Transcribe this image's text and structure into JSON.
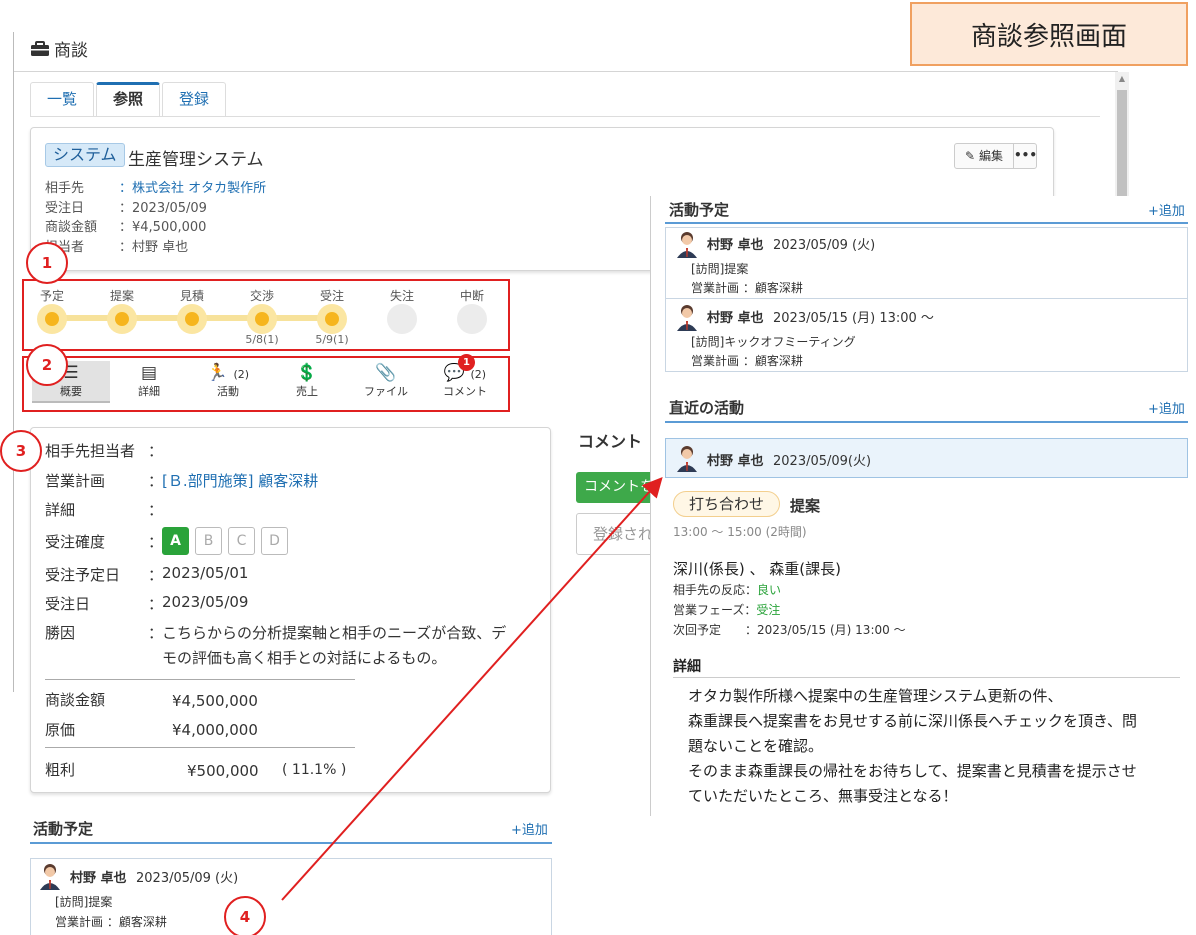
{
  "annotation": {
    "title": "商談参照画面",
    "markers": [
      "1",
      "2",
      "3",
      "4"
    ]
  },
  "header": {
    "title": "商談"
  },
  "tabs": [
    {
      "label": "一覧"
    },
    {
      "label": "参照"
    },
    {
      "label": "登録"
    }
  ],
  "deal": {
    "category": "システム",
    "name": "生産管理システム",
    "edit_label": "編集",
    "more_label": "•••",
    "info": [
      {
        "key": "相手先",
        "value": "：株式会社 オタカ製作所"
      },
      {
        "key": "受注日",
        "value": "：2023/05/09"
      },
      {
        "key": "商談金額",
        "value": "：¥4,500,000"
      },
      {
        "key": "担当者",
        "value": "：村野 卓也"
      }
    ]
  },
  "phases": [
    {
      "label": "予定",
      "state": "done",
      "date": ""
    },
    {
      "label": "提案",
      "state": "done",
      "date": ""
    },
    {
      "label": "見積",
      "state": "done",
      "date": ""
    },
    {
      "label": "交渉",
      "state": "done",
      "date": "5/8(1)"
    },
    {
      "label": "受注",
      "state": "done",
      "date": "5/9(1)"
    },
    {
      "label": "失注",
      "state": "none",
      "date": ""
    },
    {
      "label": "中断",
      "state": "none",
      "date": ""
    }
  ],
  "icon_tabs": [
    {
      "label": "概要",
      "icon": "list-icon",
      "glyph": "☰",
      "count": ""
    },
    {
      "label": "詳細",
      "icon": "clipboard-icon",
      "glyph": "▤",
      "count": ""
    },
    {
      "label": "活動",
      "icon": "running-icon",
      "glyph": "🏃",
      "count": "(2)"
    },
    {
      "label": "売上",
      "icon": "invoice-icon",
      "glyph": "💲",
      "count": ""
    },
    {
      "label": "ファイル",
      "icon": "paperclip-icon",
      "glyph": "📎",
      "count": ""
    },
    {
      "label": "コメント",
      "icon": "comment-icon",
      "glyph": "💬",
      "count": "(2)"
    }
  ],
  "comment_badge": "1",
  "detail": {
    "contact_label": "相手先担当者",
    "colon": "：",
    "plan_label": "営業計画",
    "plan_value": "[Ｂ.部門施策] 顧客深耕",
    "detail_label": "詳細",
    "grade_label": "受注確度",
    "grades": [
      "A",
      "B",
      "C",
      "D"
    ],
    "grade_selected": "A",
    "expected_label": "受注予定日",
    "expected_value": "2023/05/01",
    "order_label": "受注日",
    "order_value": "2023/05/09",
    "reason_label": "勝因",
    "reason_value": [
      "こちらからの分析提案軸と相手のニーズが合致、デ",
      "モの評価も高く相手との対話によるもの。"
    ],
    "amount_label": "商談金額",
    "amount_value": "¥4,500,000",
    "cost_label": "原価",
    "cost_value": "¥4,000,000",
    "profit_label": "粗利",
    "profit_value": "¥500,000",
    "profit_rate": "( 11.1% )"
  },
  "comments": {
    "title": "コメント",
    "button": "コメントを書く",
    "placeholder": "登録されたコメントはありません"
  },
  "left_schedule": {
    "title": "活動予定",
    "add": "+追加",
    "items": [
      {
        "name": "村野 卓也",
        "date": "2023/05/09 (火)",
        "type": "[訪問]提案",
        "plan": "営業計画 ：顧客深耕"
      }
    ]
  },
  "right_schedule": {
    "title": "活動予定",
    "add": "+追加",
    "items": [
      {
        "name": "村野 卓也",
        "date": "2023/05/09 (火)",
        "type": "[訪問]提案",
        "plan": "営業計画 ：顧客深耕"
      },
      {
        "name": "村野 卓也",
        "date": "2023/05/15 (月) 13:00 ～",
        "type": "[訪問]キックオフミーティング",
        "plan": "営業計画 ：顧客深耕"
      }
    ]
  },
  "recent": {
    "title": "直近の活動",
    "add": "+追加",
    "name": "村野 卓也",
    "date": "2023/05/09(火)",
    "badge": "打ち合わせ",
    "subject": "提案",
    "time": "13:00 ～ 15:00 (2時間)",
    "attendees": "深川(係長) 、 森重(課長)",
    "reaction_label": "相手先の反応：",
    "reaction_value": "良い",
    "phase_label": "営業フェーズ：",
    "phase_value": "受注",
    "next_label": "次回予定　　：",
    "next_value": "2023/05/15 (月) 13:00 ～",
    "detail_title": "詳細",
    "detail_lines": [
      "オタカ製作所様へ提案中の生産管理システム更新の件、",
      "森重課長へ提案書をお見せする前に深川係長へチェックを頂き、問",
      "題ないことを確認。",
      "そのまま森重課長の帰社をお待ちして、提案書と見積書を提示させ",
      "ていただいたところ、無事受注となる！"
    ]
  },
  "colors": {
    "accent": "#1f6fb2",
    "annotation": "#e02020",
    "phase": "#f6b51e",
    "green": "#2aa33a"
  }
}
